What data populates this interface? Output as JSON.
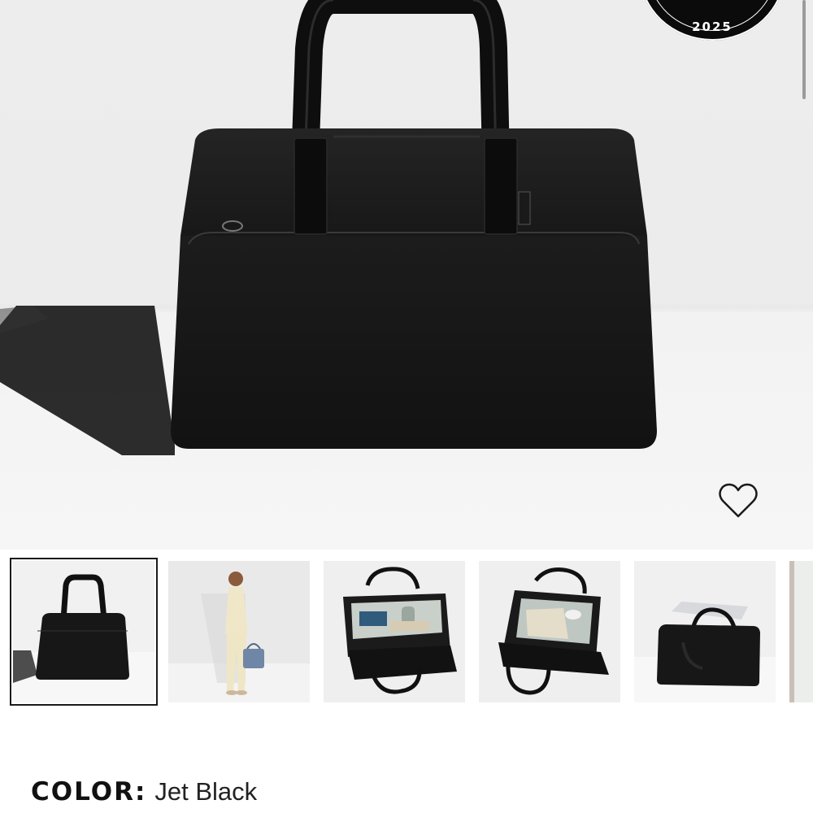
{
  "hero": {
    "badge_year": "2025",
    "favorite_icon": "heart-outline-icon"
  },
  "thumbnails": [
    {
      "name": "front-view",
      "selected": true
    },
    {
      "name": "model-carrying",
      "selected": false
    },
    {
      "name": "open-interior",
      "selected": false
    },
    {
      "name": "open-interior-angle",
      "selected": false
    },
    {
      "name": "laptop-sleeve",
      "selected": false
    },
    {
      "name": "partial-next",
      "selected": false
    }
  ],
  "product": {
    "color_label": "COLOR:",
    "color_value": "Jet Black"
  },
  "colors": {
    "bag": "#161616",
    "background": "#ededed",
    "floor": "#f5f5f5",
    "badge": "#0b0b0b"
  }
}
